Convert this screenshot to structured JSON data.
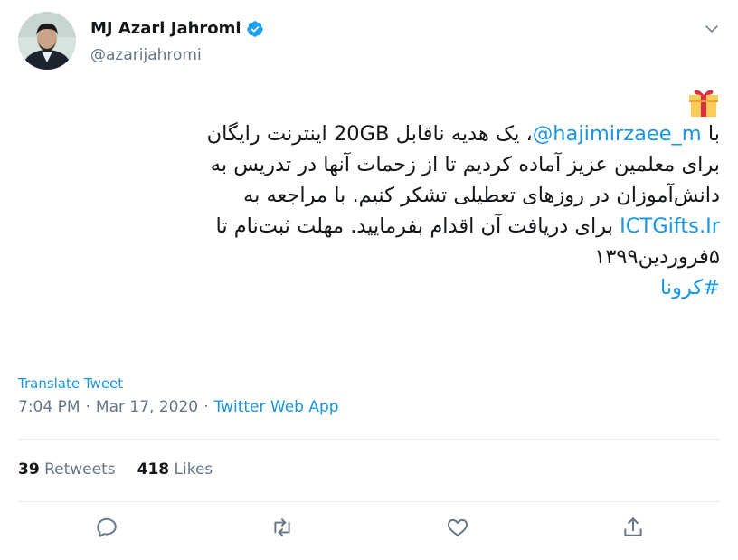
{
  "user": {
    "display_name": "MJ Azari Jahromi",
    "handle": "@azarijahromi",
    "verified": true
  },
  "tweet": {
    "emoji": "gift-icon",
    "line1_prefix": "با ",
    "mention": "@hajimirzaee_m",
    "line1_suffix": "، یک هدیه ناقابل 20GB اینترنت رایگان",
    "line2": "برای معلمین عزیز آماده کردیم تا از زحمات آنها در تدریس به",
    "line3": "دانش‌آموزان در روزهای تعطیلی تشکر کنیم. با مراجعه به",
    "link": "ICTGifts.Ir",
    "line4_suffix": " برای دریافت آن اقدام بفرمایید. مهلت ثبت‌نام تا",
    "line5": "۵فروردین۱۳۹۹",
    "hashtag": "#کرونا"
  },
  "translate_label": "Translate Tweet",
  "meta": {
    "time": "7:04 PM",
    "separator": "·",
    "date": "Mar 17, 2020",
    "source": "Twitter Web App"
  },
  "stats": {
    "retweets_count": "39",
    "retweets_label": "Retweets",
    "likes_count": "418",
    "likes_label": "Likes"
  },
  "colors": {
    "link": "#1b95e0",
    "muted": "#657786",
    "text": "#14171a",
    "divider": "#e6ecf0"
  },
  "icons": [
    "verified-badge-icon",
    "chevron-down-icon",
    "gift-icon",
    "reply-icon",
    "retweet-icon",
    "like-icon",
    "share-icon"
  ]
}
